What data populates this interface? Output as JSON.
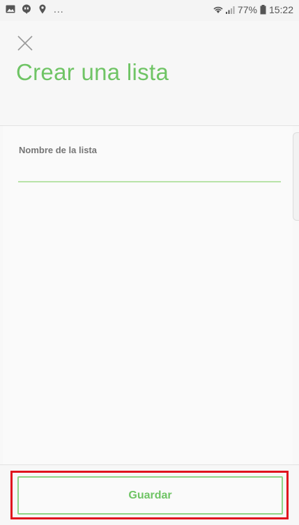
{
  "status_bar": {
    "left_icons": [
      "gallery-icon",
      "hangouts-icon",
      "location-pin-icon"
    ],
    "overflow": "...",
    "right_icons": [
      "wifi-icon",
      "signal-icon"
    ],
    "battery_percent": "77%",
    "time": "15:22"
  },
  "header": {
    "close_icon": "close-icon",
    "title": "Crear una lista"
  },
  "form": {
    "name_label": "Nombre de la lista",
    "name_value": "",
    "name_placeholder": ""
  },
  "footer": {
    "save_label": "Guardar"
  },
  "colors": {
    "accent": "#6fc465",
    "input_underline": "#b8e3a8",
    "button_border": "#8ed585",
    "highlight": "#e0141e"
  }
}
